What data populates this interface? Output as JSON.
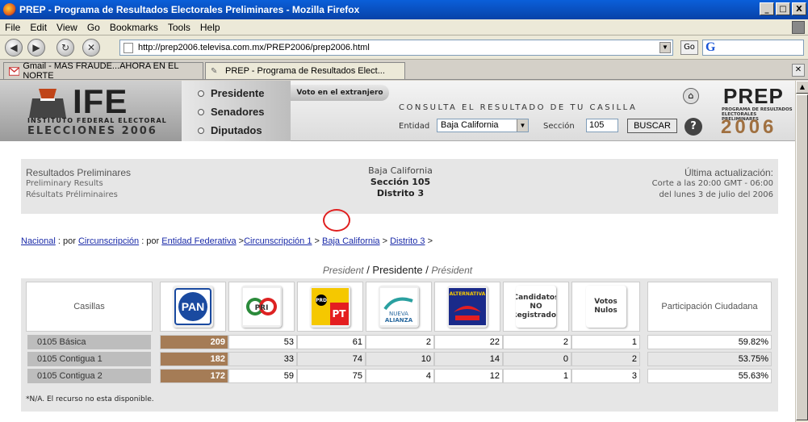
{
  "window": {
    "title": "PREP - Programa de Resultados Electorales Preliminares - Mozilla Firefox",
    "min": "_",
    "max": "□",
    "close": "X"
  },
  "menu": [
    "File",
    "Edit",
    "View",
    "Go",
    "Bookmarks",
    "Tools",
    "Help"
  ],
  "nav": {
    "url": "http://prep2006.televisa.com.mx/PREP2006/prep2006.html",
    "go_label": "Go",
    "search_logo": "G"
  },
  "tabs": [
    {
      "label": "Gmail - MAS FRAUDE...AHORA EN EL NORTE"
    },
    {
      "label": "PREP - Programa de Resultados Elect..."
    }
  ],
  "banner": {
    "ife": "IFE",
    "institute": "INSTITUTO FEDERAL ELECTORAL",
    "elections": "ELECCIONES 2006",
    "menu": [
      "Presidente",
      "Senadores",
      "Diputados"
    ],
    "voto_extranjero": "Voto en el extranjero",
    "consulta": "CONSULTA EL RESULTADO DE TU CASILLA",
    "entidad_label": "Entidad",
    "entidad_value": "Baja California",
    "seccion_label": "Sección",
    "seccion_value": "105",
    "buscar": "BUSCAR",
    "prep": "PREP",
    "prep_sub": "PROGRAMA DE RESULTADOS ELECTORALES PRELIMINARES",
    "prep_year": "2006"
  },
  "info": {
    "title": "Resultados Preliminares",
    "en": "Preliminary Results",
    "fr": "Résultats Préliminaires",
    "state": "Baja California",
    "section": "Sección 105",
    "district": "Distrito 3",
    "update_title": "Última actualización:",
    "update_line1": "Corte a las 20:00 GMT - 06:00",
    "update_line2": "del lunes 3 de julio del 2006"
  },
  "breadcrumb": {
    "nacional": "Nacional",
    "sep1": " : por ",
    "circ": "Circunscripción",
    "sep2": " : por ",
    "entidad": "Entidad Federativa",
    "sep3": " >",
    "circ1": "Circunscripción 1",
    "sep4": " > ",
    "bc": "Baja California",
    "sep5": " > ",
    "dist": "Distrito 3",
    "sep6": " >"
  },
  "election": {
    "en": "President",
    "sep1": " / ",
    "es": "Presidente",
    "sep2": " / ",
    "fr": "Président"
  },
  "table": {
    "casillas_header": "Casillas",
    "party_names": [
      "PAN",
      "PRD",
      "PRO PT",
      "NUEVA ALIANZA",
      "ALTERNATIVA"
    ],
    "cand_no_reg": "Candidatos NO Registrados",
    "votos_nulos": "Votos Nulos",
    "participacion": "Participación Ciudadana",
    "rows": [
      {
        "label": "0105 Básica",
        "values": [
          "209",
          "53",
          "61",
          "2",
          "22",
          "2",
          "1"
        ],
        "part": "59.82%"
      },
      {
        "label": "0105 Contigua 1",
        "values": [
          "182",
          "33",
          "74",
          "10",
          "14",
          "0",
          "2"
        ],
        "part": "53.75%"
      },
      {
        "label": "0105 Contigua 2",
        "values": [
          "172",
          "59",
          "75",
          "4",
          "12",
          "1",
          "3"
        ],
        "part": "55.63%"
      }
    ],
    "note": "*N/A. El recurso no esta disponible."
  },
  "colors": {
    "winner": "#a57c56",
    "pan": "#1a4aa0",
    "prd": "#f5c800",
    "pt": "#e41e20",
    "alianza": "#2aa0a0"
  }
}
